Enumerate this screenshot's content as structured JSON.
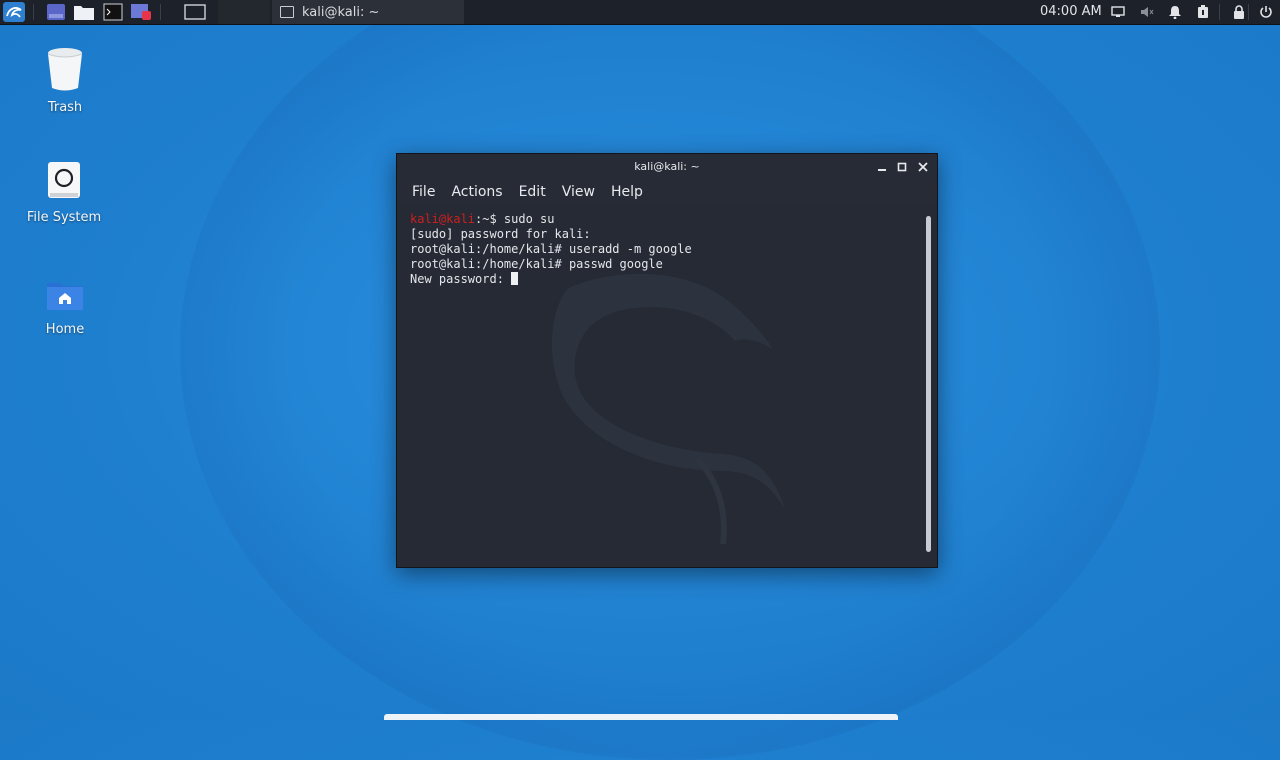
{
  "taskbar": {
    "window_task_title": "kali@kali: ~",
    "clock": "04:00 AM"
  },
  "desktop": {
    "icons": [
      {
        "label": "Trash",
        "icon": "trash-icon"
      },
      {
        "label": "File System",
        "icon": "drive-icon"
      },
      {
        "label": "Home",
        "icon": "home-folder-icon"
      }
    ]
  },
  "terminal": {
    "title": "kali@kali: ~",
    "menu": [
      "File",
      "Actions",
      "Edit",
      "View",
      "Help"
    ],
    "lines": {
      "l1_user": "kali@kali",
      "l1_rest": ":~$ sudo su",
      "l2": "[sudo] password for kali:",
      "l3": "root@kali:/home/kali# useradd -m google",
      "l4": "root@kali:/home/kali# passwd google",
      "l5": "New password: "
    }
  },
  "colors": {
    "desktop_bg": "#2486d6",
    "terminal_bg": "#252a34",
    "prompt_user": "#d01f1f",
    "taskbar_bg": "#1d2129"
  }
}
